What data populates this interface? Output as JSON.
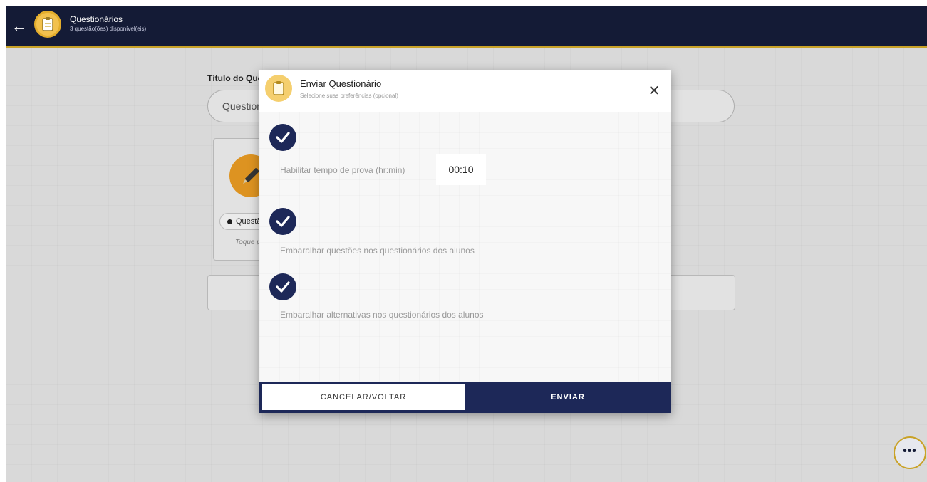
{
  "header": {
    "title": "Questionários",
    "subtitle": "3 questão(ões) disponível(eis)"
  },
  "page": {
    "title_label": "Título do Questionário",
    "title_value": "Questionário",
    "card_chip": "Questão",
    "card_hint": "Toque para editar"
  },
  "modal": {
    "title": "Enviar Questionário",
    "subtitle": "Selecione suas preferências (opcional)",
    "options": [
      {
        "label": "Habilitar tempo de prova (hr:min)",
        "checked": true
      },
      {
        "label": "Embaralhar questões nos questionários dos alunos",
        "checked": true
      },
      {
        "label": "Embaralhar alternativas nos questionários dos alunos",
        "checked": true
      }
    ],
    "time_value": "00:10",
    "cancel_label": "CANCELAR/VOLTAR",
    "send_label": "ENVIAR"
  },
  "fab_label": "•••",
  "colors": {
    "navy": "#141b36",
    "modal_navy": "#1d2858",
    "gold": "#c9a227",
    "orange": "#f0a024"
  },
  "icons": {
    "back": "arrow-left-icon",
    "clipboard": "clipboard-icon",
    "close": "close-icon",
    "check": "checkmark-icon",
    "pencil": "pencil-icon",
    "more": "more-dots-icon"
  }
}
